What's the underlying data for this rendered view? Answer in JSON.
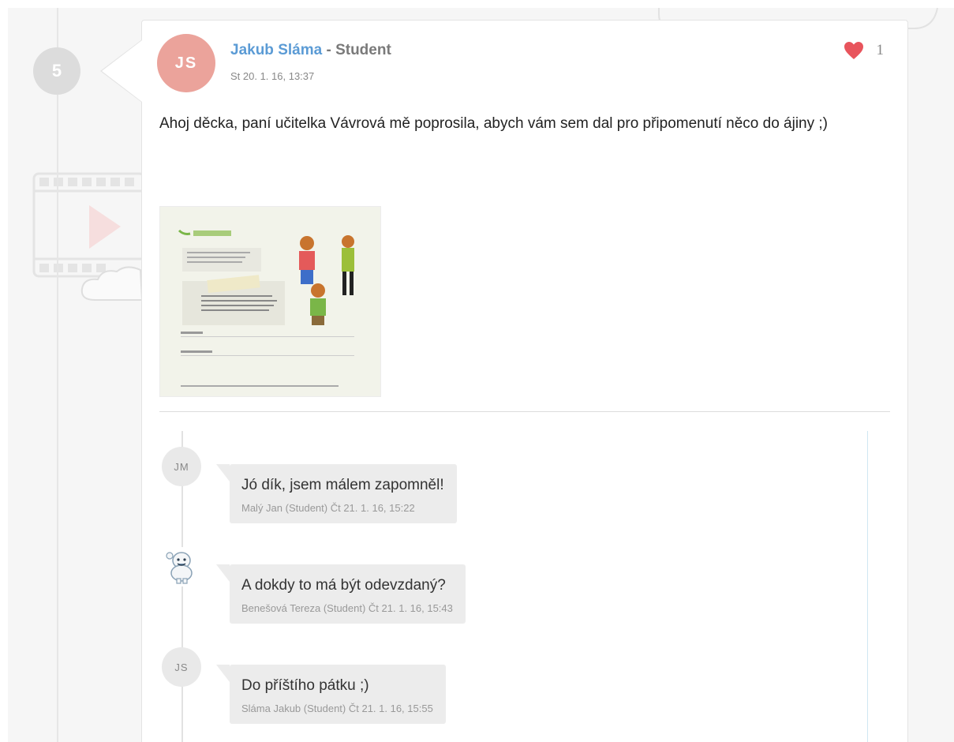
{
  "timeline": {
    "step_number": "5"
  },
  "post": {
    "avatar_initials": "JS",
    "author_name": "Jakub Sláma",
    "author_separator": " - ",
    "author_role": "Student",
    "date": "St 20. 1. 16, 13:37",
    "likes": "1",
    "text": "Ahoj děcka, paní učitelka Vávrová mě poprosila, abych vám sem dal pro připomenutí něco do ájiny ;)",
    "attachment_icon": "worksheet-thumbnail"
  },
  "comments": [
    {
      "avatar": "JM",
      "text": "Jó dík, jsem málem zapomněl!",
      "meta": "Malý Jan (Student) Čt 21. 1. 16, 15:22"
    },
    {
      "avatar_icon": "yeti-avatar",
      "text": "A dokdy to má být odevzdaný?",
      "meta": "Benešová Tereza (Student) Čt 21. 1. 16, 15:43"
    },
    {
      "avatar": "JS",
      "text": "Do příštího pátku ;)",
      "meta": "Sláma Jakub (Student) Čt 21. 1. 16, 15:55"
    }
  ],
  "colors": {
    "accent": "#5b9bd5",
    "avatar": "#eba39b",
    "heart": "#e8545c"
  }
}
